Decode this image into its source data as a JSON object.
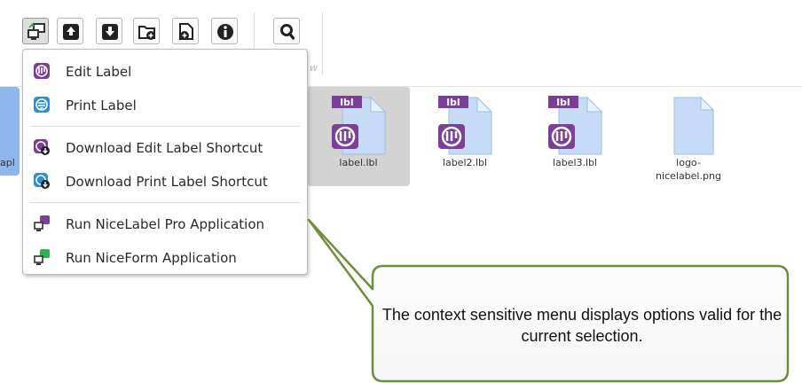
{
  "toolbar": {
    "buttons": [
      {
        "name": "run-application",
        "icon": "run-application-icon"
      },
      {
        "name": "upload",
        "icon": "upload-icon"
      },
      {
        "name": "download",
        "icon": "download-icon"
      },
      {
        "name": "new-folder",
        "icon": "new-folder-icon"
      },
      {
        "name": "new-file",
        "icon": "new-file-icon"
      },
      {
        "name": "info",
        "icon": "info-icon"
      },
      {
        "name": "search",
        "icon": "search-icon"
      }
    ],
    "group_caption": "w"
  },
  "files": {
    "partial_left_label": "apl",
    "items": [
      {
        "name": "label.lbl",
        "type": "lbl",
        "selected": true
      },
      {
        "name": "label2.lbl",
        "type": "lbl",
        "selected": false
      },
      {
        "name": "label3.lbl",
        "type": "lbl",
        "selected": false
      },
      {
        "name": "logo-\nnicelabel.png",
        "type": "png",
        "selected": false
      }
    ],
    "badge_text": "lbl"
  },
  "context_menu": {
    "items": [
      {
        "label": "Edit Label",
        "icon": "edit-label-icon"
      },
      {
        "label": "Print Label",
        "icon": "print-label-icon"
      },
      {
        "label": "Download Edit Label Shortcut",
        "icon": "download-edit-shortcut-icon"
      },
      {
        "label": "Download Print Label Shortcut",
        "icon": "download-print-shortcut-icon"
      },
      {
        "label": "Run NiceLabel Pro Application",
        "icon": "run-nicelabel-pro-icon"
      },
      {
        "label": "Run NiceForm Application",
        "icon": "run-niceform-icon"
      }
    ]
  },
  "callout": {
    "text": "The context sensitive menu displays options valid for the current selection."
  },
  "colors": {
    "purple": "#7b3f98",
    "blue": "#2e8fd8",
    "callout_border": "#6d8e3c",
    "file_blue": "#c6dcf6",
    "selection": "#d3d3d3"
  }
}
